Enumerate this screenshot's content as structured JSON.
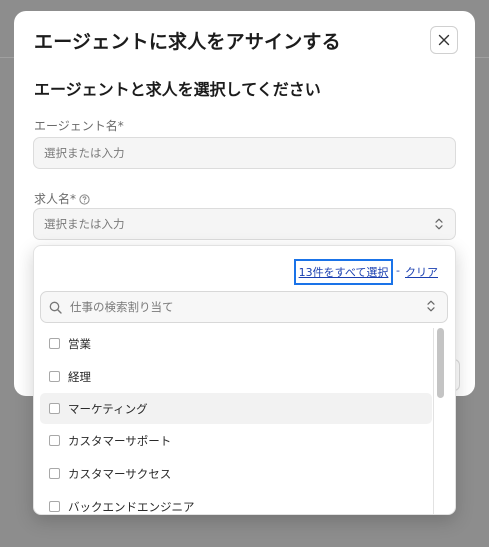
{
  "modal": {
    "title": "エージェントに求人をアサインする",
    "subtitle": "エージェントと求人を選択してください",
    "agent_field": {
      "label": "エージェント名*",
      "placeholder": "選択または入力"
    },
    "job_field": {
      "label": "求人名*",
      "placeholder": "選択または入力"
    },
    "icons": {
      "close": "close-icon",
      "help": "help-circle-icon",
      "stepper": "chevron-up-down-icon"
    }
  },
  "dropdown": {
    "select_all_label": "13件をすべて選択",
    "separator": "-",
    "clear_label": "クリア",
    "search_placeholder": "仕事の検索割り当て",
    "search_icon": "search-icon",
    "items": [
      {
        "label": "営業",
        "checked": false
      },
      {
        "label": "経理",
        "checked": false
      },
      {
        "label": "マーケティング",
        "checked": false,
        "hovered": true
      },
      {
        "label": "カスタマーサポート",
        "checked": false
      },
      {
        "label": "カスタマーサクセス",
        "checked": false
      },
      {
        "label": "バックエンドエンジニア",
        "checked": false
      }
    ]
  },
  "colors": {
    "link": "#1a3fb0",
    "focus_outline": "#1a73e8",
    "overlay": "#8d8d8d"
  }
}
